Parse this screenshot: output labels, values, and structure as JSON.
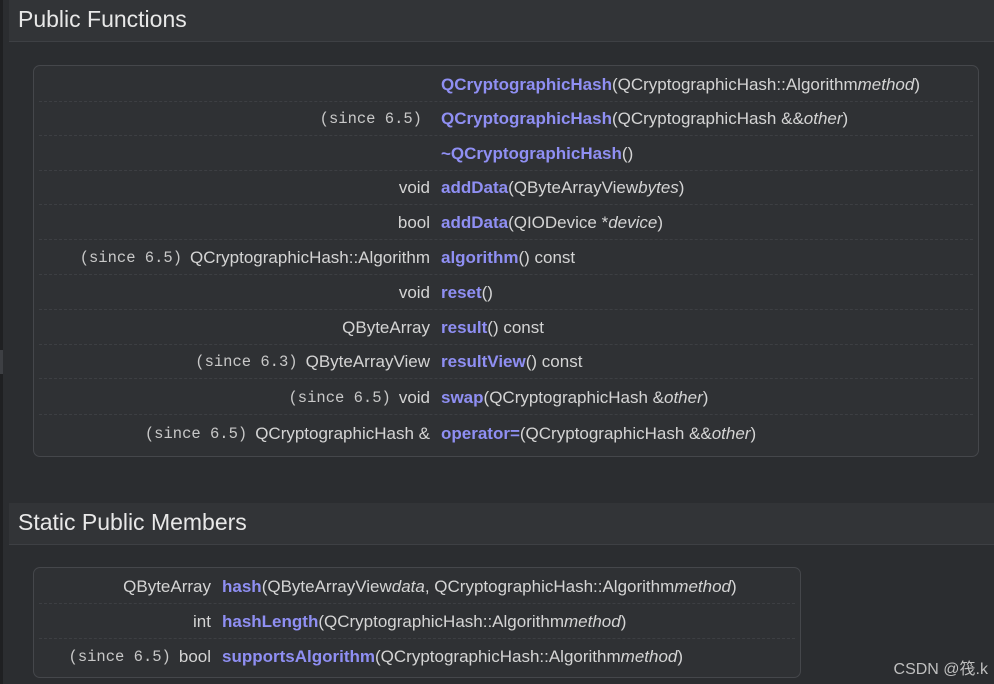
{
  "sections": [
    {
      "title": "Public Functions",
      "rows": [
        {
          "since": "",
          "ret": "",
          "name": "QCryptographicHash",
          "pre": "(QCryptographicHash::Algorithm ",
          "param": "method",
          "post": ")"
        },
        {
          "since": "(since 6.5)",
          "ret": "",
          "name": "QCryptographicHash",
          "pre": "(QCryptographicHash &&",
          "param": "other",
          "post": ")"
        },
        {
          "since": "",
          "ret": "",
          "name": "~QCryptographicHash",
          "pre": "()",
          "param": "",
          "post": ""
        },
        {
          "since": "",
          "ret": "void",
          "name": "addData",
          "pre": "(QByteArrayView ",
          "param": "bytes",
          "post": ")"
        },
        {
          "since": "",
          "ret": "bool",
          "name": "addData",
          "pre": "(QIODevice *",
          "param": "device",
          "post": ")"
        },
        {
          "since": "(since 6.5)",
          "ret": "QCryptographicHash::Algorithm",
          "name": "algorithm",
          "pre": "() const",
          "param": "",
          "post": ""
        },
        {
          "since": "",
          "ret": "void",
          "name": "reset",
          "pre": "()",
          "param": "",
          "post": ""
        },
        {
          "since": "",
          "ret": "QByteArray",
          "name": "result",
          "pre": "() const",
          "param": "",
          "post": ""
        },
        {
          "since": "(since 6.3)",
          "ret": "QByteArrayView",
          "name": "resultView",
          "pre": "() const",
          "param": "",
          "post": ""
        },
        {
          "since": "(since 6.5)",
          "ret": "void",
          "name": "swap",
          "pre": "(QCryptographicHash &",
          "param": "other",
          "post": ")"
        },
        {
          "since": "(since 6.5)",
          "ret": "QCryptographicHash &",
          "name": "operator=",
          "pre": "(QCryptographicHash &&",
          "param": "other",
          "post": ")"
        }
      ]
    },
    {
      "title": "Static Public Members",
      "rows": [
        {
          "since": "",
          "ret": "QByteArray",
          "name": "hash",
          "pre": "(QByteArrayView ",
          "param": "data",
          "mid": ", QCryptographicHash::Algorithm ",
          "param2": "method",
          "post": ")"
        },
        {
          "since": "",
          "ret": "int",
          "name": "hashLength",
          "pre": "(QCryptographicHash::Algorithm ",
          "param": "method",
          "post": ")"
        },
        {
          "since": "(since 6.5)",
          "ret": "bool",
          "name": "supportsAlgorithm",
          "pre": "(QCryptographicHash::Algorithm ",
          "param": "method",
          "post": ")"
        }
      ]
    }
  ],
  "watermark": "CSDN @筏.k",
  "colors": {
    "background": "#2b2d30",
    "link": "#8f8ff3",
    "text": "#dcdcdc"
  }
}
